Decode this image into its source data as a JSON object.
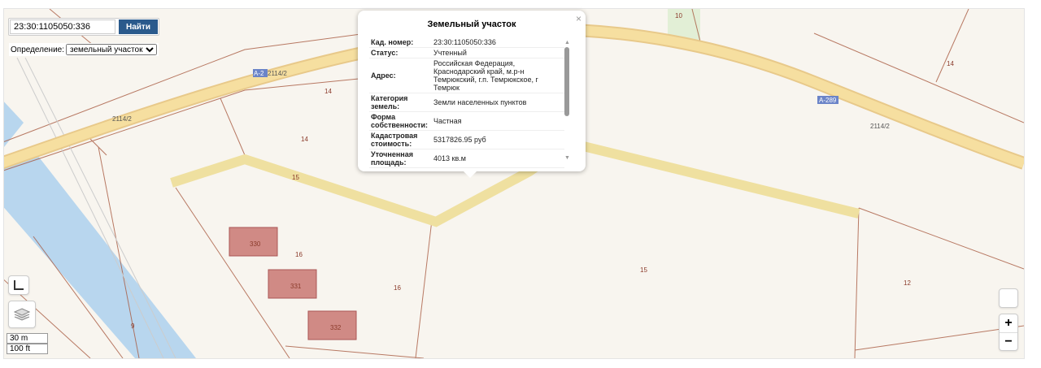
{
  "search": {
    "value": "23:30:1105050:336",
    "button": "Найти"
  },
  "definition": {
    "label": "Определение:",
    "selected": "земельный участок"
  },
  "popup": {
    "title": "Земельный участок",
    "close": "×",
    "rows": [
      {
        "key": "Кад. номер:",
        "value": "23:30:1105050:336"
      },
      {
        "key": "Статус:",
        "value": "Учтенный"
      },
      {
        "key": "Адрес:",
        "value": "Российская Федерация, Краснодарский край, м.р-н Темрюкский, г.п. Темрюкское, г Темрюк"
      },
      {
        "key": "Категория земель:",
        "value": "Земли населенных пунктов"
      },
      {
        "key": "Форма собственности:",
        "value": "Частная"
      },
      {
        "key": "Кадастровая стоимость:",
        "value": "5317826.95 руб"
      },
      {
        "key": "Уточненная площадь:",
        "value": "4013 кв.м"
      }
    ]
  },
  "map": {
    "labels": [
      "14",
      "14",
      "15",
      "16",
      "16",
      "15",
      "12",
      "14",
      "10",
      "9"
    ],
    "buildings": [
      "330",
      "331",
      "332"
    ],
    "roads": {
      "a289": "А-289",
      "a2": "А-2",
      "r1": "2114/2",
      "r2": "2114/2",
      "r3": "2114/2"
    }
  },
  "scale": {
    "metric": "30 m",
    "imperial": "100 ft"
  },
  "zoom": {
    "in": "+",
    "out": "−"
  }
}
